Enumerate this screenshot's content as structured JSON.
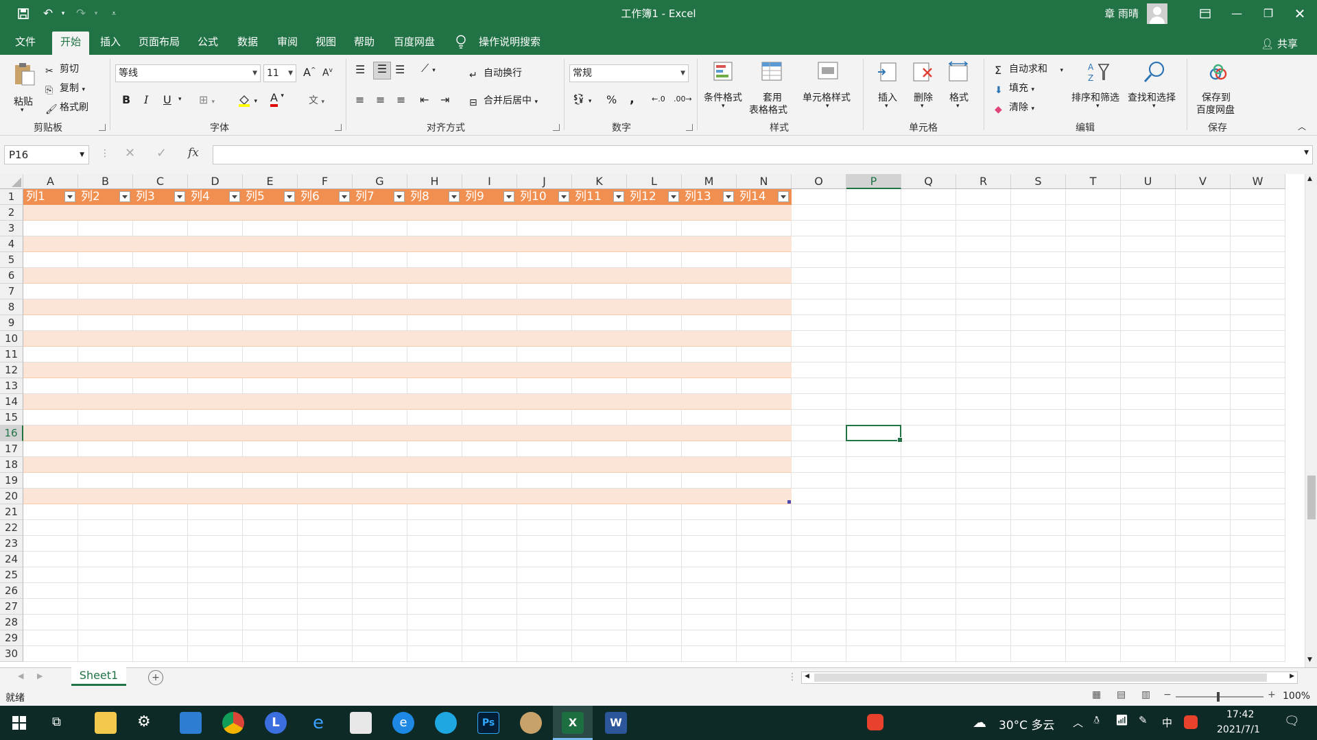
{
  "window": {
    "title": "工作簿1  -  Excel",
    "user_name": "章 雨晴"
  },
  "menu": {
    "tabs": [
      "文件",
      "开始",
      "插入",
      "页面布局",
      "公式",
      "数据",
      "审阅",
      "视图",
      "帮助",
      "百度网盘"
    ],
    "active_tab": "开始",
    "tell_me": "操作说明搜索",
    "share": "共享"
  },
  "ribbon": {
    "clipboard": {
      "paste": "粘贴",
      "cut": "剪切",
      "copy": "复制",
      "format_painter": "格式刷",
      "label": "剪贴板"
    },
    "font": {
      "font_name": "等线",
      "font_size": "11",
      "bold": "B",
      "italic": "I",
      "underline": "U",
      "font_color_glyph": "A",
      "label": "字体"
    },
    "alignment": {
      "wrap_text": "自动换行",
      "merge_center": "合并后居中",
      "label": "对齐方式"
    },
    "number": {
      "format": "常规",
      "percent": "%",
      "comma": ",",
      "label": "数字"
    },
    "styles": {
      "conditional": "条件格式",
      "table_format_1": "套用",
      "table_format_2": "表格格式",
      "cell_styles": "单元格样式",
      "label": "样式"
    },
    "cells": {
      "insert": "插入",
      "delete": "删除",
      "format": "格式",
      "label": "单元格"
    },
    "editing": {
      "autosum": "自动求和",
      "fill": "填充",
      "clear": "清除",
      "sort_filter": "排序和筛选",
      "find_select": "查找和选择",
      "label": "编辑"
    },
    "save": {
      "save_1": "保存到",
      "save_2": "百度网盘",
      "label": "保存"
    }
  },
  "formula_bar": {
    "name_box": "P16",
    "fx": "fx",
    "formula": ""
  },
  "grid": {
    "columns": [
      "A",
      "B",
      "C",
      "D",
      "E",
      "F",
      "G",
      "H",
      "I",
      "J",
      "K",
      "L",
      "M",
      "N",
      "O",
      "P",
      "Q",
      "R",
      "S",
      "T",
      "U",
      "V",
      "W"
    ],
    "rows": [
      "1",
      "2",
      "3",
      "4",
      "5",
      "6",
      "7",
      "8",
      "9",
      "10",
      "11",
      "12",
      "13",
      "14",
      "15",
      "16",
      "17",
      "18",
      "19",
      "20",
      "21",
      "22",
      "23",
      "24",
      "25",
      "26",
      "27",
      "28",
      "29",
      "30"
    ],
    "table_headers": [
      "列1",
      "列2",
      "列3",
      "列4",
      "列5",
      "列6",
      "列7",
      "列8",
      "列9",
      "列10",
      "列11",
      "列12",
      "列13",
      "列14"
    ],
    "selected_cell": "P16",
    "colors": {
      "header": "#f08f4f",
      "band": "#fce4d6",
      "accent": "#217346"
    }
  },
  "sheets": {
    "tabs": [
      "Sheet1"
    ],
    "active": "Sheet1"
  },
  "status": {
    "ready": "就绪",
    "zoom": "100%"
  },
  "taskbar": {
    "weather": "30°C  多云",
    "ime": "中",
    "time": "17:42",
    "date": "2021/7/1"
  }
}
